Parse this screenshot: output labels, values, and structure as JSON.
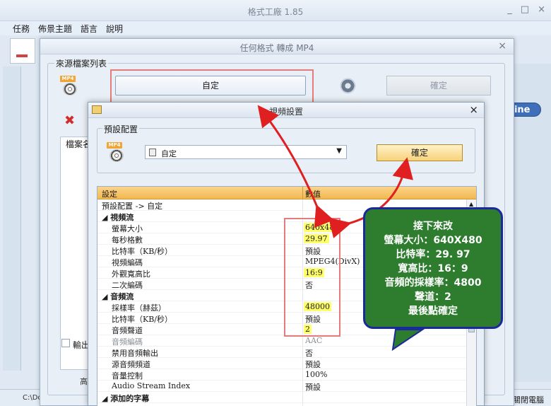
{
  "app": {
    "title": "格式工廠 1.85",
    "win_min": "_",
    "win_max": "□",
    "win_close": "×"
  },
  "menu": [
    "任務",
    "佈景主題",
    "語言",
    "說明"
  ],
  "online_label": "line",
  "status": {
    "path": "C:\\Documents and Se",
    "right": "後：關閉電腦"
  },
  "dialog1": {
    "title": "任何格式 轉成 MP4",
    "source_group": "來源檔案列表",
    "custom_button": "自定",
    "ok_button": "確定",
    "list_header": "檔案名",
    "output_label": "輸出",
    "high_label": "高"
  },
  "dialog2": {
    "title": "視頻設置",
    "preset_group": "預設配置",
    "preset_value": "自定",
    "ok_button": "確定",
    "grid_header": {
      "setting": "設定",
      "value": "數值"
    }
  },
  "rows": [
    {
      "k": "預設配置 -> 自定",
      "v": "",
      "type": "top"
    },
    {
      "k": "◢ 視頻流",
      "v": "",
      "type": "section"
    },
    {
      "k": "螢幕大小",
      "v": "640x480",
      "hl": true
    },
    {
      "k": "每秒格數",
      "v": "29.97",
      "hl": true
    },
    {
      "k": "比特率（KB/秒）",
      "v": "預設"
    },
    {
      "k": "視頻編碼",
      "v": "MPEG4(DivX)"
    },
    {
      "k": "外觀寬高比",
      "v": "16:9",
      "hl": true
    },
    {
      "k": "二次編碼",
      "v": "否"
    },
    {
      "k": "◢ 音頻流",
      "v": "",
      "type": "section"
    },
    {
      "k": "採樣率（赫茲）",
      "v": "48000",
      "hl": true
    },
    {
      "k": "比特率（KB/秒）",
      "v": "預設"
    },
    {
      "k": "音頻聲道",
      "v": "2",
      "hl": true
    },
    {
      "k": "音頻編碼",
      "v": "AAC",
      "type": "dim"
    },
    {
      "k": "禁用音頻輸出",
      "v": "否"
    },
    {
      "k": "源音頻頻道",
      "v": "預設"
    },
    {
      "k": "音量控制",
      "v": "100%"
    },
    {
      "k": "Audio Stream Index",
      "v": "預設"
    },
    {
      "k": "◢ 添加的字幕",
      "v": "",
      "type": "section"
    }
  ],
  "callout": [
    "接下來改",
    "螢幕大小：640X480",
    "比特率：29. 97",
    "寬高比：16：9",
    "音頻的採樣率：4800",
    "聲道：2",
    "最後點確定"
  ]
}
